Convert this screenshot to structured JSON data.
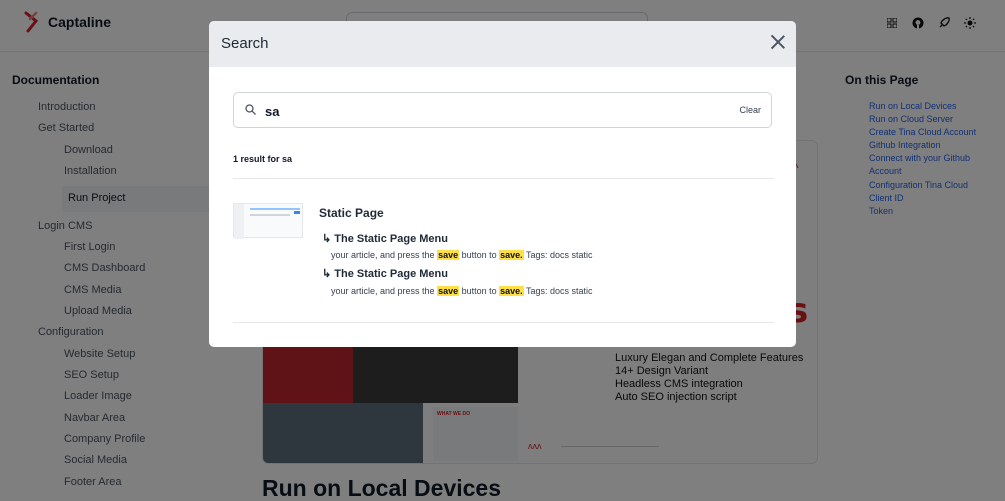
{
  "header": {
    "brand": "Captaline",
    "icons": [
      "grid-icon",
      "github-icon",
      "rocket-icon",
      "sun-icon"
    ]
  },
  "sidebar": {
    "title": "Documentation",
    "items": [
      {
        "label": "Introduction"
      },
      {
        "label": "Get Started"
      },
      {
        "label": "Download"
      },
      {
        "label": "Installation"
      },
      {
        "label": "Run Project"
      },
      {
        "label": "Login CMS"
      },
      {
        "label": "First Login"
      },
      {
        "label": "CMS Dashboard"
      },
      {
        "label": "CMS Media"
      },
      {
        "label": "Upload Media"
      },
      {
        "label": "Configuration"
      },
      {
        "label": "Website Setup"
      },
      {
        "label": "SEO Setup"
      },
      {
        "label": "Loader Image"
      },
      {
        "label": "Navbar Area"
      },
      {
        "label": "Company Profile"
      },
      {
        "label": "Social Media"
      },
      {
        "label": "Footer Area"
      }
    ]
  },
  "on_this_page": {
    "title": "On this Page",
    "items": [
      "Run on Local Devices",
      "Run on Cloud Server",
      "Create Tina Cloud Account",
      "Github Integration",
      "Connect with your Github",
      "Account",
      "Configuration Tina Cloud",
      "Client ID",
      "Token"
    ]
  },
  "hero": {
    "features": [
      "Luxury Elegan and Complete Features",
      "14+ Design Variant",
      "Headless CMS integration",
      "Auto SEO injection script"
    ],
    "what_we_do": "WHAT WE DO"
  },
  "main": {
    "heading": "Run on Local Devices"
  },
  "search_modal": {
    "title": "Search",
    "query": "sa",
    "clear_label": "Clear",
    "result_count": "1 result for sa",
    "results": [
      {
        "title": "Static Page",
        "matches": [
          {
            "heading": "The Static Page Menu",
            "text_before": "your article, and press the ",
            "hl1": "save",
            "text_mid": " button to ",
            "hl2": "save.",
            "text_after": " Tags: docs static"
          },
          {
            "heading": "The Static Page Menu",
            "text_before": "your article, and press the ",
            "hl1": "save",
            "text_mid": " button to ",
            "hl2": "save.",
            "text_after": " Tags: docs static"
          }
        ]
      }
    ]
  }
}
